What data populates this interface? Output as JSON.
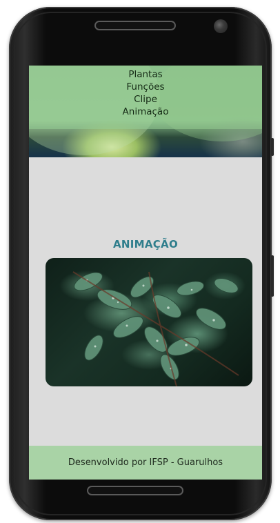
{
  "nav": {
    "items": [
      {
        "label": "Plantas"
      },
      {
        "label": "Funções"
      },
      {
        "label": "Clipe"
      },
      {
        "label": "Animação"
      }
    ]
  },
  "main": {
    "title": "ANIMAÇÃO"
  },
  "footer": {
    "text": "Desenvolvido por IFSP - Guarulhos"
  },
  "colors": {
    "title": "#2f7e8c",
    "footer_bg": "#a9d3a6",
    "screen_bg": "#dcdcdc"
  }
}
